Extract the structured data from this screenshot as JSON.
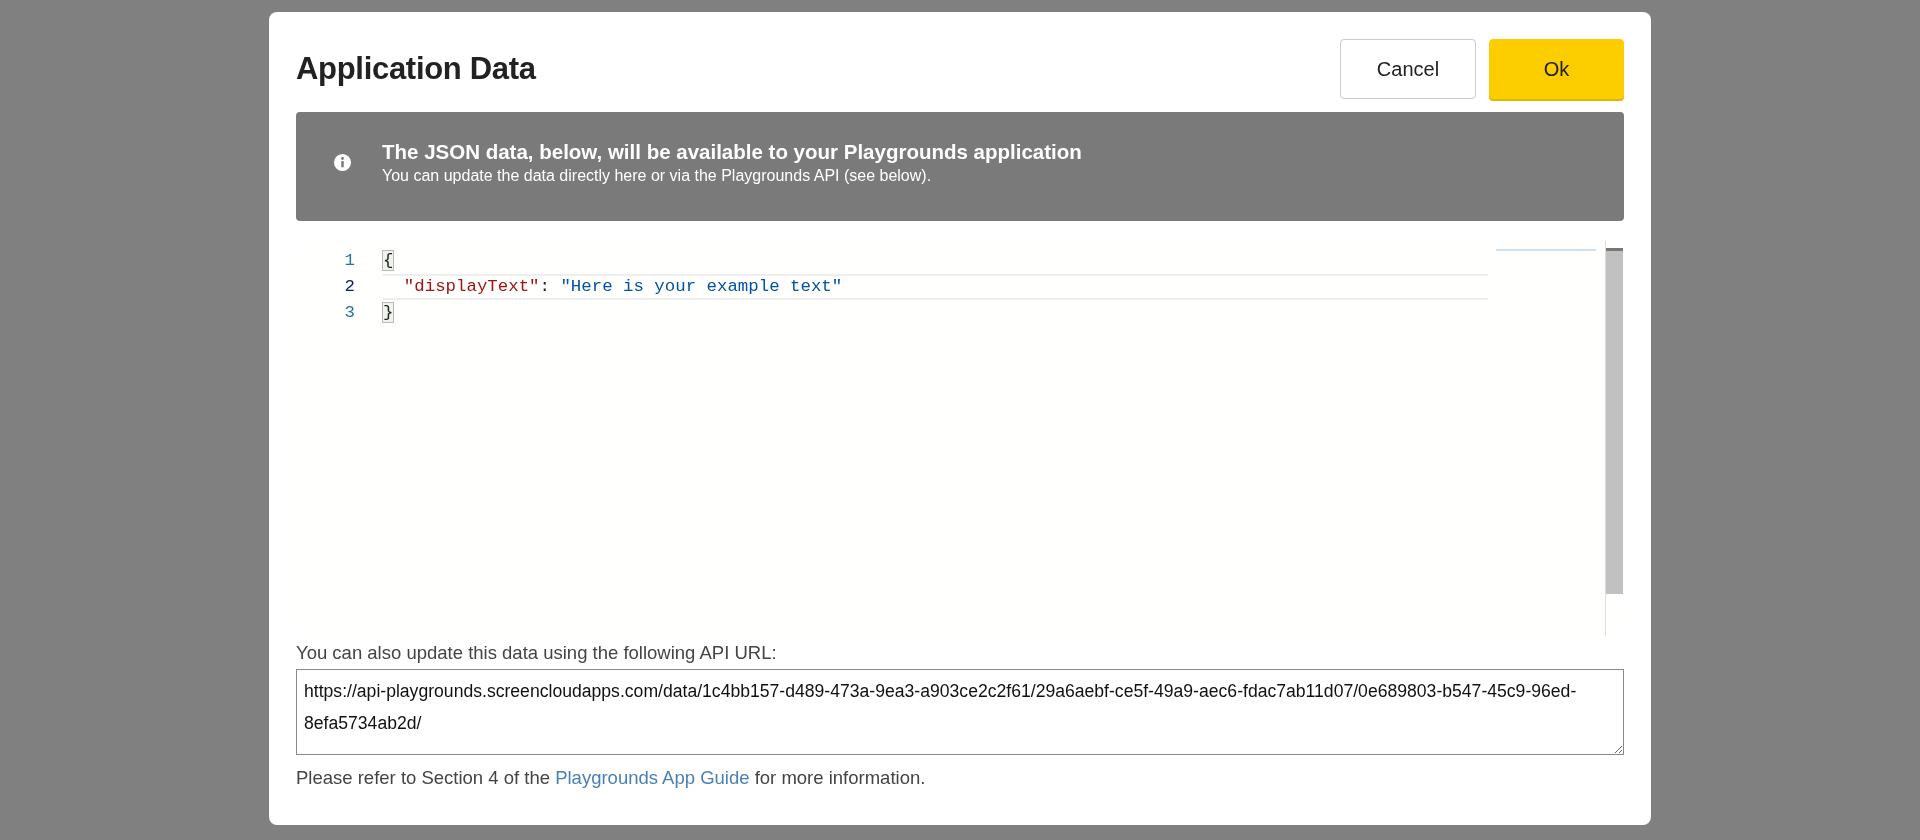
{
  "dialog": {
    "title": "Application Data",
    "buttons": [
      {
        "label": "Cancel",
        "kind": "secondary"
      },
      {
        "label": "Ok",
        "kind": "primary"
      }
    ]
  },
  "banner": {
    "title": "The JSON data, below, will be available to your Playgrounds application",
    "text": "You can update the data directly here or via the Playgrounds API (see below)."
  },
  "editor": {
    "lines": [
      {
        "number": "1",
        "current": false,
        "tokens": [
          {
            "text": "{",
            "kind": "bracket-match"
          }
        ]
      },
      {
        "number": "2",
        "current": true,
        "tokens": [
          {
            "text": "  \"displayText\"",
            "kind": "key"
          },
          {
            "text": ": ",
            "kind": "punct"
          },
          {
            "text": "\"Here is your example text\"",
            "kind": "string"
          }
        ]
      },
      {
        "number": "3",
        "current": false,
        "tokens": [
          {
            "text": "}",
            "kind": "bracket-match"
          }
        ]
      }
    ]
  },
  "api": {
    "label": "You can also update this data using the following API URL:",
    "url": "https://api-playgrounds.screencloudapps.com/data/1c4bb157-d489-473a-9ea3-a903ce2c2f61/29a6aebf-ce5f-49a9-aec6-fdac7ab11d07/0e689803-b547-45c9-96ed-8efa5734ab2d/"
  },
  "footer": {
    "before": "Please refer to Section 4 of the ",
    "link": "Playgrounds App Guide",
    "after": " for more information."
  }
}
